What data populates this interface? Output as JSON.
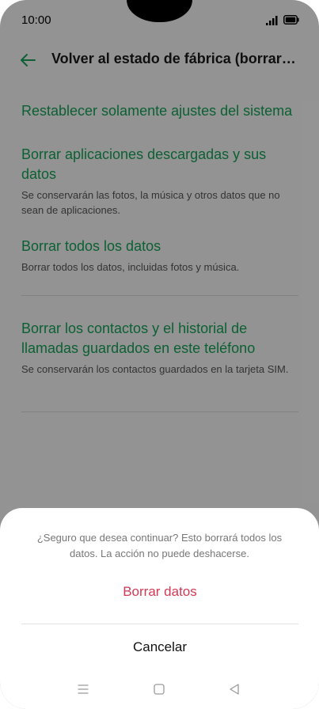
{
  "status_bar": {
    "time": "10:00",
    "icons": [
      "signal-icon",
      "battery-icon"
    ]
  },
  "header": {
    "back_icon": "arrow-left-icon",
    "title": "Volver al estado de fábrica (borrar to..."
  },
  "options": [
    {
      "title": "Restablecer solamente ajustes del sistema",
      "description": ""
    },
    {
      "title": "Borrar aplicaciones descargadas y sus datos",
      "description": "Se conservarán las fotos, la música y otros datos que no sean de aplicaciones."
    },
    {
      "title": "Borrar todos los datos",
      "description": "Borrar todos los datos, incluidas fotos y música."
    },
    {
      "title": "Borrar los contactos y el historial de llamadas guardados en este teléfono",
      "description": "Se conservarán los contactos guardados en la tarjeta SIM."
    }
  ],
  "dialog": {
    "message": "¿Seguro que desea continuar? Esto borrará todos los datos. La acción no puede deshacerse.",
    "confirm_label": "Borrar datos",
    "cancel_label": "Cancelar"
  },
  "nav_bar": {
    "icons": [
      "menu-icon",
      "home-icon",
      "back-icon"
    ]
  },
  "colors": {
    "accent_green": "#15a056",
    "destructive_red": "#d13a55"
  }
}
